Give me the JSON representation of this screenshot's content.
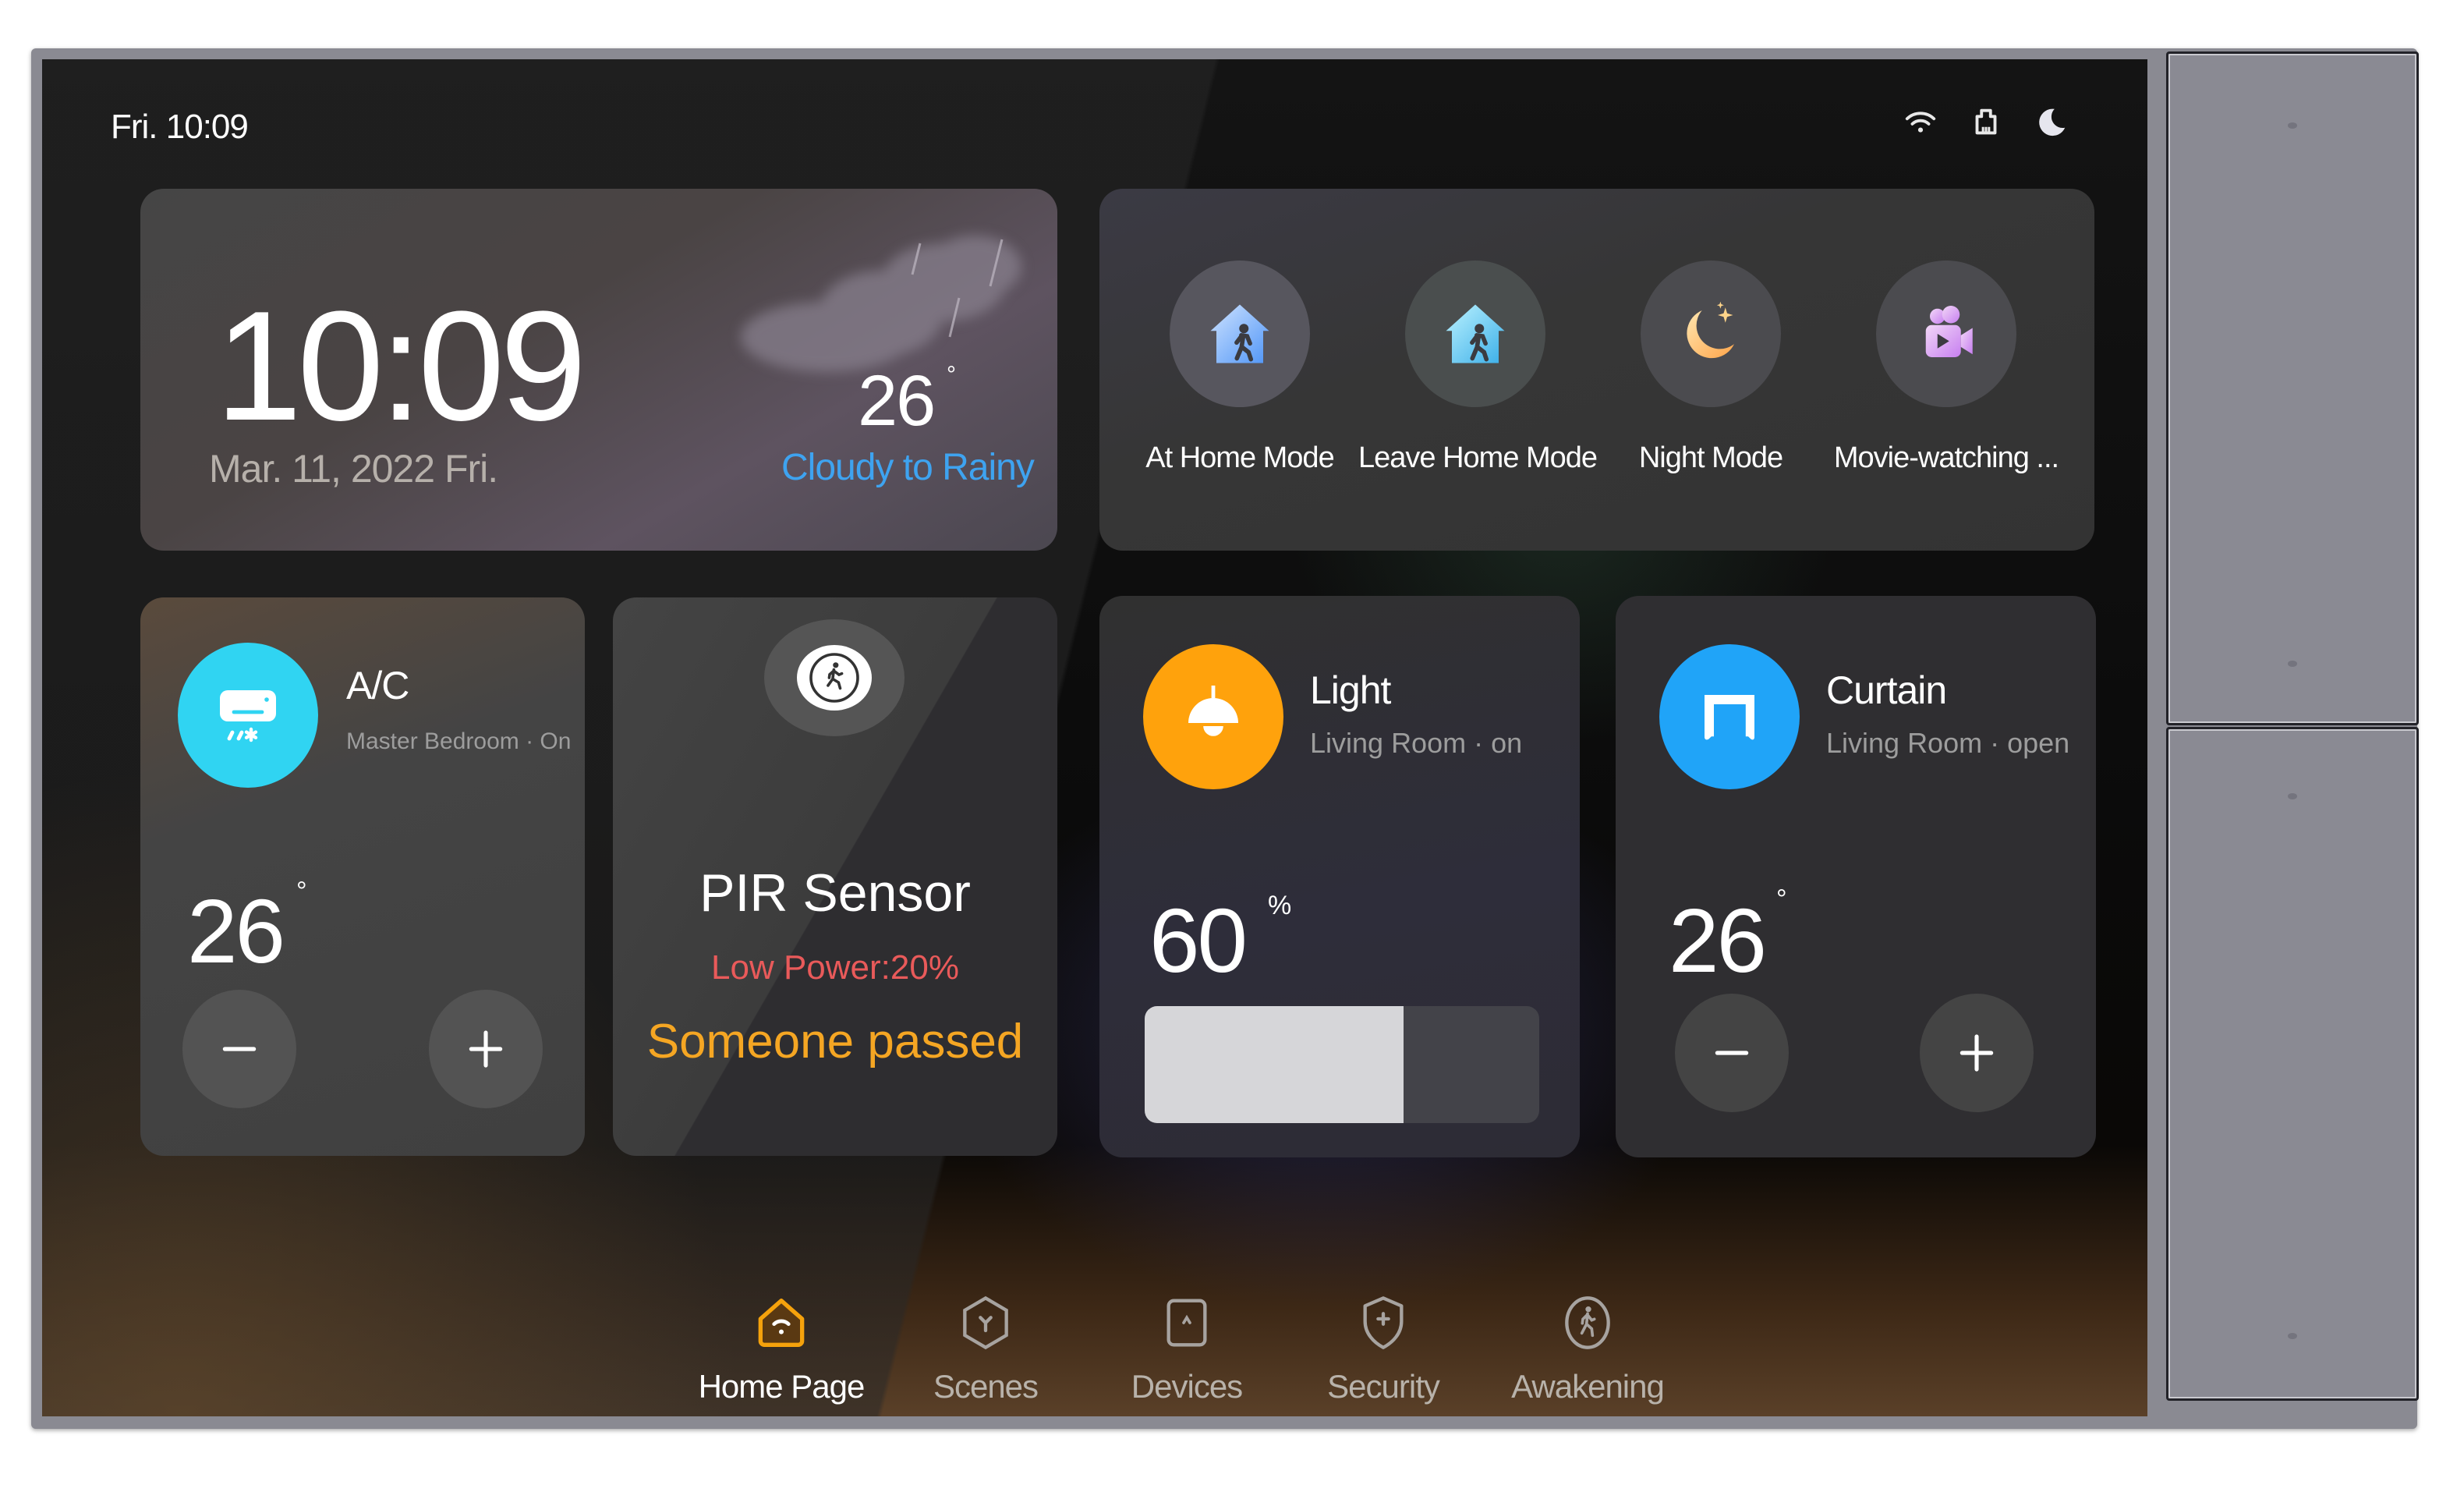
{
  "status_bar": {
    "time": "Fri. 10:09",
    "icons": [
      "wifi-icon",
      "ethernet-icon",
      "moon-icon"
    ]
  },
  "clock": {
    "time": "10:09",
    "date": "Mar. 11, 2022  Fri."
  },
  "weather": {
    "temperature": "26",
    "unit": "°",
    "description": "Cloudy to Rainy",
    "icon": "cloud-rain-icon"
  },
  "scenes": [
    {
      "label": "At Home Mode",
      "icon": "home-walk-in-icon"
    },
    {
      "label": "Leave Home Mode",
      "icon": "home-walk-out-icon"
    },
    {
      "label": "Night Mode",
      "icon": "moon-stars-icon"
    },
    {
      "label": "Movie-watching ...",
      "icon": "video-camera-icon"
    }
  ],
  "devices": {
    "ac": {
      "title": "A/C",
      "subtitle": "Master Bedroom · On",
      "value": "26",
      "unit": "°",
      "icon": "air-conditioner-icon",
      "color": "#30d4f2",
      "minus_icon": "minus-icon",
      "plus_icon": "plus-icon"
    },
    "pir": {
      "title": "PIR Sensor",
      "battery_warning": "Low Power:20%",
      "event": "Someone passed",
      "icon": "motion-sensor-icon",
      "warning_color": "#e95a5a",
      "event_color": "#f5a623"
    },
    "light": {
      "title": "Light",
      "subtitle": "Living Room · on",
      "value": "60",
      "unit": "%",
      "brightness_fraction": 0.6,
      "icon": "pendant-lamp-icon",
      "color": "#ffa20c"
    },
    "curtain": {
      "title": "Curtain",
      "subtitle": "Living Room · open",
      "value": "26",
      "unit": "°",
      "icon": "curtain-icon",
      "color": "#20a4f8",
      "minus_icon": "minus-icon",
      "plus_icon": "plus-icon"
    }
  },
  "nav": {
    "active": "Home Page",
    "active_color": "#f5a20c",
    "items": [
      {
        "label": "Home Page",
        "icon": "home-wifi-icon"
      },
      {
        "label": "Scenes",
        "icon": "hexagon-y-icon"
      },
      {
        "label": "Devices",
        "icon": "device-square-icon"
      },
      {
        "label": "Security",
        "icon": "shield-plus-icon"
      },
      {
        "label": "Awakening",
        "icon": "walking-person-icon"
      }
    ]
  },
  "side_panel": {
    "buttons": [
      "upper-rocker-button",
      "lower-rocker-button"
    ]
  }
}
